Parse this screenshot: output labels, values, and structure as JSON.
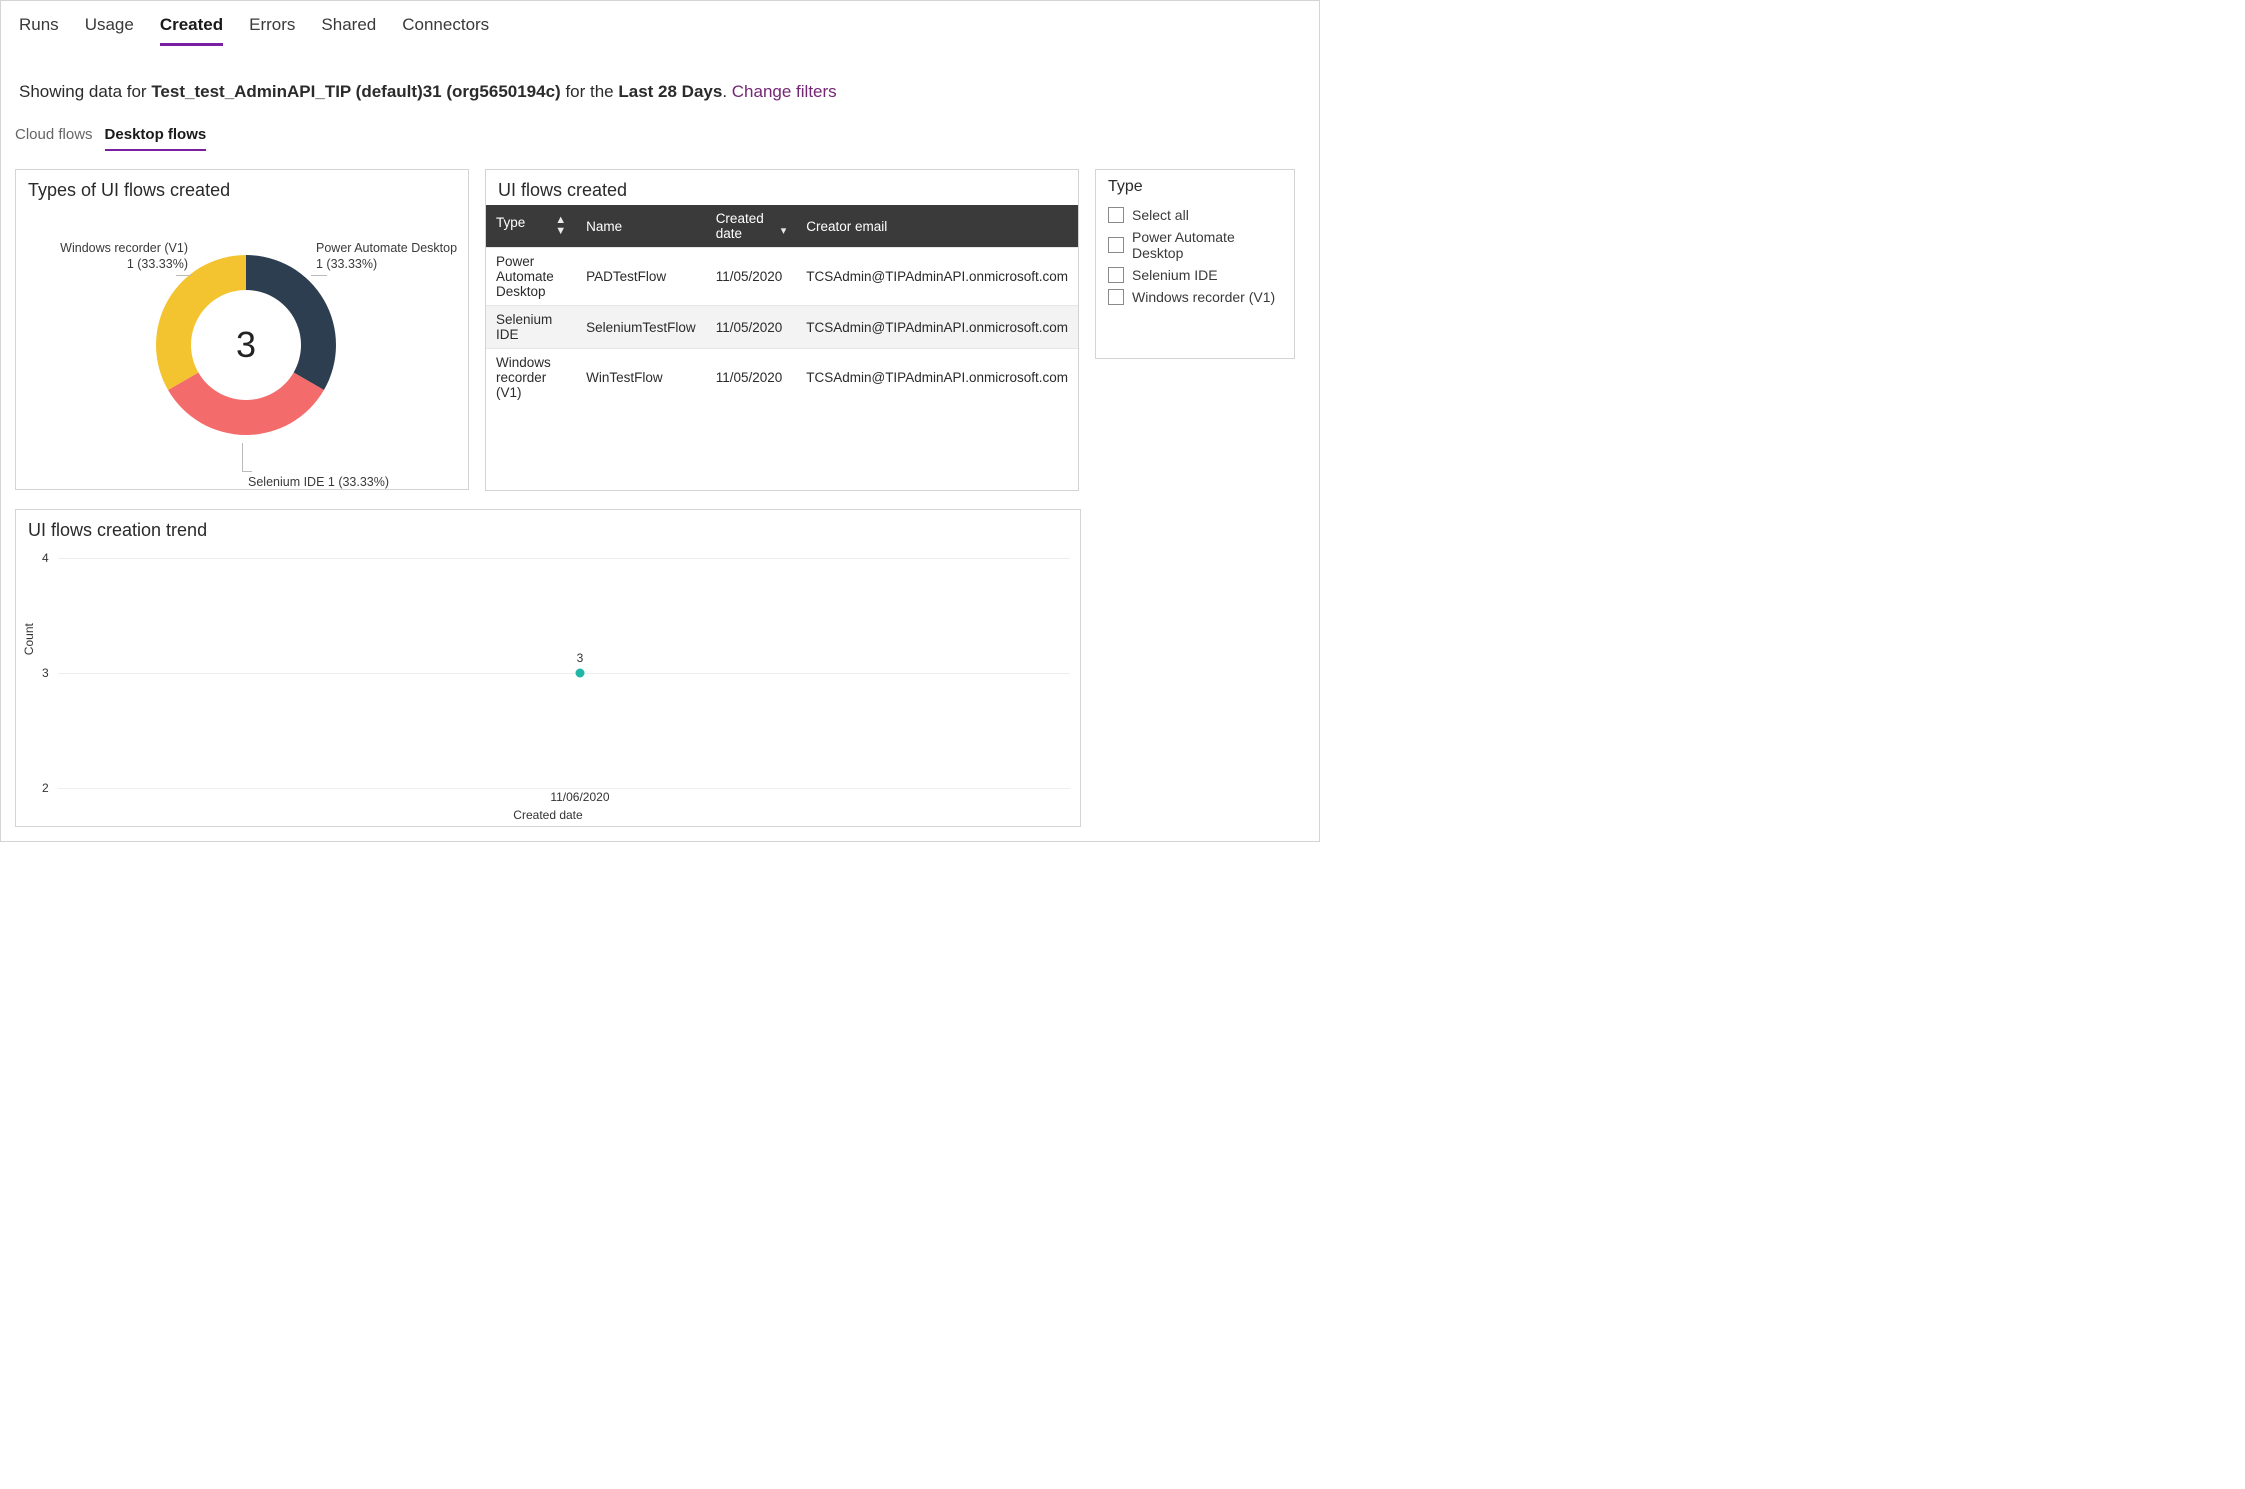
{
  "top_tabs": {
    "items": [
      "Runs",
      "Usage",
      "Created",
      "Errors",
      "Shared",
      "Connectors"
    ],
    "active_index": 2
  },
  "summary": {
    "prefix": "Showing data for ",
    "env": "Test_test_AdminAPI_TIP (default)31 (org5650194c)",
    "mid": " for the ",
    "period": "Last 28 Days",
    "suffix": ". ",
    "change_filters": "Change filters"
  },
  "sub_tabs": {
    "items": [
      "Cloud flows",
      "Desktop flows"
    ],
    "active_index": 1
  },
  "types_card": {
    "title": "Types of UI flows created",
    "center_value": "3",
    "labels": {
      "right_line1": "Power Automate Desktop",
      "right_line2": "1 (33.33%)",
      "left_line1": "Windows recorder (V1)",
      "left_line2": "1 (33.33%)",
      "bottom": "Selenium IDE 1 (33.33%)"
    }
  },
  "table_card": {
    "title": "UI flows created",
    "columns": [
      "Type",
      "Name",
      "Created date",
      "Creator email"
    ],
    "sort_column_index": 2,
    "rows": [
      {
        "type": "Power Automate Desktop",
        "name": "PADTestFlow",
        "date": "11/05/2020",
        "email": "TCSAdmin@TIPAdminAPI.onmicrosoft.com"
      },
      {
        "type": "Selenium IDE",
        "name": "SeleniumTestFlow",
        "date": "11/05/2020",
        "email": "TCSAdmin@TIPAdminAPI.onmicrosoft.com"
      },
      {
        "type": "Windows recorder (V1)",
        "name": "WinTestFlow",
        "date": "11/05/2020",
        "email": "TCSAdmin@TIPAdminAPI.onmicrosoft.com"
      }
    ]
  },
  "filter_card": {
    "title": "Type",
    "options": [
      "Select all",
      "Power Automate Desktop",
      "Selenium IDE",
      "Windows recorder (V1)"
    ]
  },
  "trend_card": {
    "title": "UI flows creation trend",
    "ylabel": "Count",
    "xlabel": "Created date",
    "yticks": [
      "4",
      "3",
      "2"
    ],
    "xticks": [
      "11/06/2020"
    ],
    "point_label": "3"
  },
  "chart_data": [
    {
      "type": "pie",
      "title": "Types of UI flows created",
      "categories": [
        "Power Automate Desktop",
        "Windows recorder (V1)",
        "Selenium IDE"
      ],
      "values": [
        1,
        1,
        1
      ],
      "percentages": [
        33.33,
        33.33,
        33.33
      ],
      "colors": [
        "#2c3e50",
        "#f4c430",
        "#f36b6b"
      ],
      "center_total": 3
    },
    {
      "type": "table",
      "title": "UI flows created",
      "columns": [
        "Type",
        "Name",
        "Created date",
        "Creator email"
      ],
      "rows": [
        [
          "Power Automate Desktop",
          "PADTestFlow",
          "11/05/2020",
          "TCSAdmin@TIPAdminAPI.onmicrosoft.com"
        ],
        [
          "Selenium IDE",
          "SeleniumTestFlow",
          "11/05/2020",
          "TCSAdmin@TIPAdminAPI.onmicrosoft.com"
        ],
        [
          "Windows recorder (V1)",
          "WinTestFlow",
          "11/05/2020",
          "TCSAdmin@TIPAdminAPI.onmicrosoft.com"
        ]
      ]
    },
    {
      "type": "line",
      "title": "UI flows creation trend",
      "xlabel": "Created date",
      "ylabel": "Count",
      "ylim": [
        2,
        4
      ],
      "x": [
        "11/06/2020"
      ],
      "series": [
        {
          "name": "Count",
          "values": [
            3
          ]
        }
      ]
    }
  ]
}
